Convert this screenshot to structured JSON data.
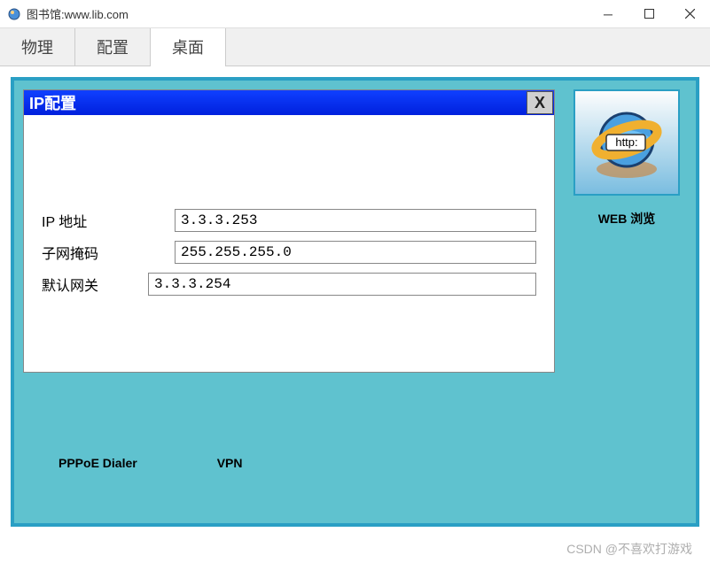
{
  "window": {
    "title": "图书馆:www.lib.com"
  },
  "tabs": {
    "physical": "物理",
    "config": "配置",
    "desktop": "桌面"
  },
  "ip_dialog": {
    "title": "IP配置",
    "close_label": "X",
    "fields": {
      "ip_label": "IP 地址",
      "ip_value": "3.3.3.253",
      "subnet_label": "子网掩码",
      "subnet_value": "255.255.255.0",
      "gateway_label": "默认网关",
      "gateway_value": "3.3.3.254"
    }
  },
  "background_apps": {
    "pppoe": "PPPoE Dialer",
    "vpn": "VPN"
  },
  "web_browser": {
    "label": "WEB 浏览",
    "badge": "http:"
  },
  "watermark": "CSDN @不喜欢打游戏"
}
